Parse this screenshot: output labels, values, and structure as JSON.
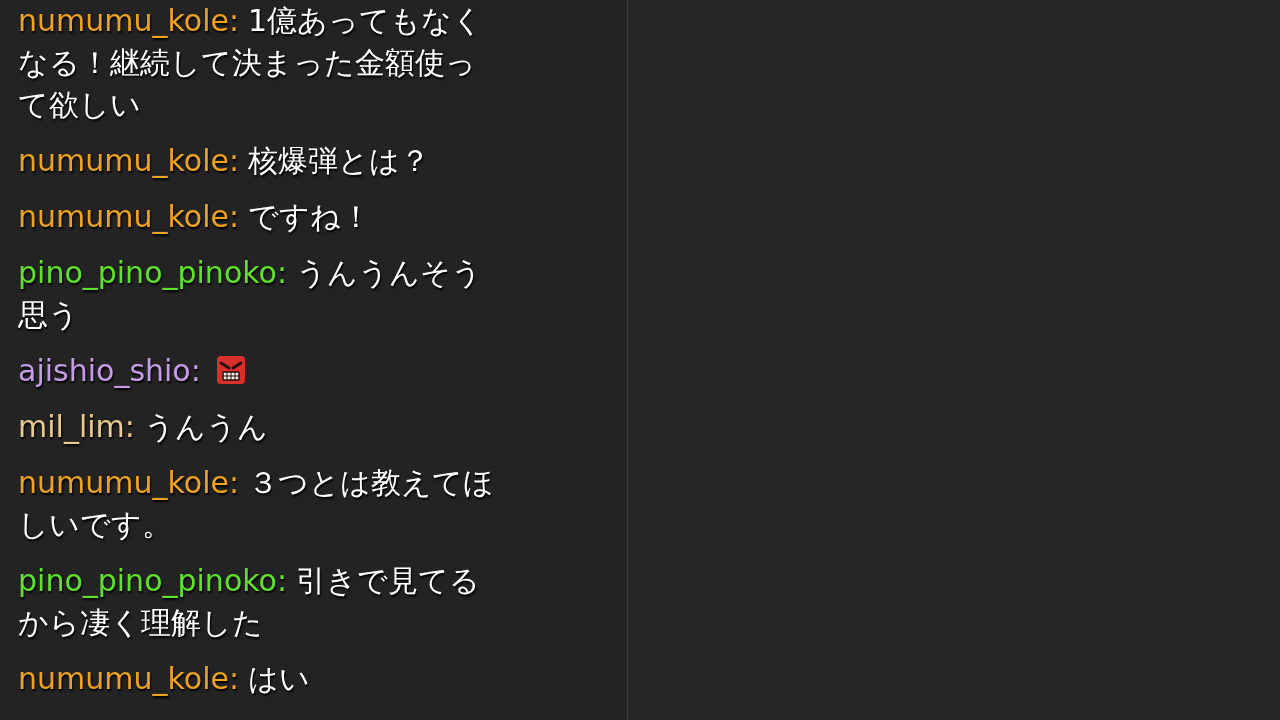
{
  "chat": {
    "messages": [
      {
        "user": "numumu_kole:",
        "color": "#eea21e",
        "kind": "text",
        "text": "1億あってもなくなる！継続して決まった金額使って欲しい"
      },
      {
        "user": "numumu_kole:",
        "color": "#eea21e",
        "kind": "text",
        "text": "核爆弾とは？"
      },
      {
        "user": "numumu_kole:",
        "color": "#eea21e",
        "kind": "text",
        "text": "ですね！"
      },
      {
        "user": "pino_pino_pinoko:",
        "color": "#5fe12c",
        "kind": "text",
        "text": "うんうんそう思う"
      },
      {
        "user": "ajishio_shio:",
        "color": "#c69ce6",
        "kind": "emote"
      },
      {
        "user": "mil_lim:",
        "color": "#e8c98e",
        "kind": "text",
        "text": "うんうん"
      },
      {
        "user": "numumu_kole:",
        "color": "#eea21e",
        "kind": "text",
        "text": "３つとは教えてほしいです。"
      },
      {
        "user": "pino_pino_pinoko:",
        "color": "#5fe12c",
        "kind": "text",
        "text": "引きで見てるから凄く理解した"
      },
      {
        "user": "numumu_kole:",
        "color": "#eea21e",
        "kind": "text",
        "text": "はい"
      }
    ]
  }
}
